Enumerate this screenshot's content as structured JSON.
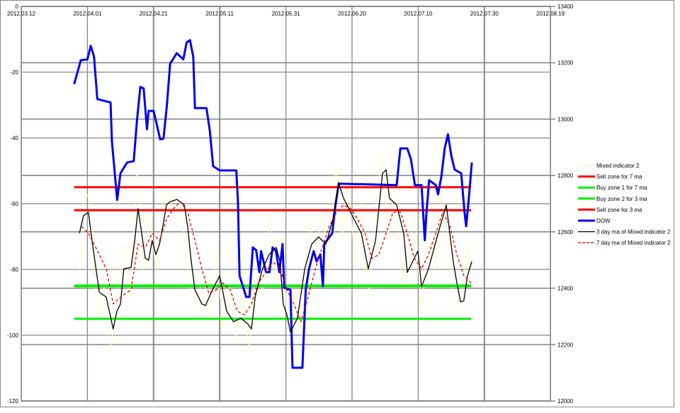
{
  "chart_data": {
    "type": "line",
    "title": "",
    "x_unit": "days since 2012.03.12",
    "x_ticks": [
      "2012.03.12",
      "2012.04.01",
      "2012.04.21",
      "2012.05.11",
      "2012.05.31",
      "2012.06.20",
      "2012.07.10",
      "2012.07.30",
      "2012.08.19"
    ],
    "xlim": [
      0,
      160
    ],
    "y_left": {
      "ticks": [
        "0",
        "-20",
        "-40",
        "-60",
        "-80",
        "-100",
        "-120"
      ],
      "ylim": [
        -120,
        0
      ]
    },
    "y_right": {
      "ticks": [
        "13400",
        "13200",
        "13000",
        "12800",
        "12600",
        "12400",
        "12200",
        "12000"
      ],
      "ylim": [
        12000,
        13400
      ]
    },
    "grid": true,
    "legend_position": "right",
    "series": [
      {
        "name": "Mixed indicator 2",
        "axis": "left",
        "color": "#ffffc8",
        "width": 1,
        "dash": false,
        "points": [
          [
            17.6,
            -80
          ],
          [
            19,
            -55
          ],
          [
            21,
            -60
          ],
          [
            23,
            -95
          ],
          [
            25,
            -85
          ],
          [
            27,
            -105
          ],
          [
            29,
            -88
          ],
          [
            31,
            -72
          ],
          [
            33,
            -88
          ],
          [
            35,
            -50
          ],
          [
            37,
            -80
          ],
          [
            39,
            -62
          ],
          [
            41,
            -85
          ],
          [
            43,
            -55
          ],
          [
            45,
            -62
          ],
          [
            47,
            -52
          ],
          [
            49,
            -68
          ],
          [
            51,
            -85
          ],
          [
            53,
            -92
          ],
          [
            55,
            -80
          ],
          [
            57,
            -96
          ],
          [
            59,
            -75
          ],
          [
            61,
            -98
          ],
          [
            63,
            -85
          ],
          [
            65,
            -102
          ],
          [
            67,
            -88
          ],
          [
            69,
            -105
          ],
          [
            71,
            -75
          ],
          [
            73,
            -88
          ],
          [
            75,
            -62
          ],
          [
            77,
            -82
          ],
          [
            79,
            -70
          ],
          [
            81,
            -108
          ],
          [
            83,
            -88
          ],
          [
            85,
            -100
          ],
          [
            87,
            -65
          ],
          [
            89,
            -78
          ],
          [
            91,
            -62
          ],
          [
            93,
            -80
          ],
          [
            95,
            -48
          ],
          [
            97,
            -70
          ],
          [
            99,
            -55
          ],
          [
            101,
            -80
          ],
          [
            103,
            -60
          ],
          [
            105,
            -88
          ],
          [
            107,
            -62
          ],
          [
            109,
            -45
          ],
          [
            111,
            -70
          ],
          [
            113,
            -52
          ],
          [
            115,
            -85
          ],
          [
            117,
            -75
          ],
          [
            119,
            -62
          ],
          [
            121,
            -95
          ],
          [
            123,
            -68
          ],
          [
            125,
            -80
          ],
          [
            127,
            -55
          ],
          [
            129,
            -70
          ],
          [
            131,
            -92
          ],
          [
            133,
            -88
          ],
          [
            135,
            -72
          ],
          [
            136,
            -80
          ]
        ]
      },
      {
        "name": "Sell zone for 7 ma",
        "axis": "left",
        "color": "#ff0000",
        "width": 3,
        "dash": false,
        "points": [
          [
            16,
            -55
          ],
          [
            136,
            -55
          ]
        ]
      },
      {
        "name": "Buy zone 1 for 7 ma",
        "axis": "left",
        "color": "#00ee00",
        "width": 4,
        "dash": false,
        "points": [
          [
            16,
            -85
          ],
          [
            136,
            -85
          ]
        ]
      },
      {
        "name": "Buy zone 2 for 3 ma",
        "axis": "left",
        "color": "#00ee00",
        "width": 3,
        "dash": false,
        "points": [
          [
            16,
            -95
          ],
          [
            136,
            -95
          ]
        ]
      },
      {
        "name": "Sell zone for 3 ma",
        "axis": "left",
        "color": "#ff0000",
        "width": 3,
        "dash": false,
        "points": [
          [
            16,
            -62
          ],
          [
            136,
            -62
          ]
        ]
      },
      {
        "name": "DOW",
        "axis": "right",
        "color": "#0000ee",
        "width": 3,
        "dash": false,
        "points": [
          [
            16,
            13124
          ],
          [
            18,
            13209
          ],
          [
            20,
            13212
          ],
          [
            21,
            13260
          ],
          [
            22,
            13222
          ],
          [
            23,
            13071
          ],
          [
            27,
            13059
          ],
          [
            27.4,
            12921
          ],
          [
            29,
            12713
          ],
          [
            30,
            12808
          ],
          [
            32,
            12846
          ],
          [
            34,
            12851
          ],
          [
            35,
            12996
          ],
          [
            36,
            13114
          ],
          [
            37,
            13109
          ],
          [
            38,
            12964
          ],
          [
            38.5,
            13029
          ],
          [
            40,
            13029
          ],
          [
            41,
            12979
          ],
          [
            42,
            12928
          ],
          [
            43,
            12931
          ],
          [
            44,
            13046
          ],
          [
            45,
            13197
          ],
          [
            47,
            13234
          ],
          [
            49,
            13212
          ],
          [
            50,
            13272
          ],
          [
            51,
            13280
          ],
          [
            52,
            13222
          ],
          [
            52.5,
            13039
          ],
          [
            56,
            13039
          ],
          [
            57,
            12959
          ],
          [
            58,
            12833
          ],
          [
            60,
            12818
          ],
          [
            65,
            12818
          ],
          [
            65.5,
            12708
          ],
          [
            66,
            12444
          ],
          [
            68,
            12369
          ],
          [
            69,
            12369
          ],
          [
            70,
            12545
          ],
          [
            71,
            12535
          ],
          [
            72,
            12457
          ],
          [
            72.5,
            12532
          ],
          [
            74,
            12457
          ],
          [
            75,
            12457
          ],
          [
            76,
            12545
          ],
          [
            77,
            12532
          ],
          [
            78,
            12457
          ],
          [
            79,
            12557
          ],
          [
            79.5,
            12402
          ],
          [
            81.4,
            12394
          ],
          [
            82,
            12118
          ],
          [
            85,
            12118
          ],
          [
            86,
            12394
          ],
          [
            87,
            12470
          ],
          [
            88.4,
            12532
          ],
          [
            89.3,
            12495
          ],
          [
            90.4,
            12520
          ],
          [
            91.2,
            12407
          ],
          [
            91.6,
            12557
          ],
          [
            94,
            12595
          ],
          [
            95,
            12695
          ],
          [
            96,
            12771
          ],
          [
            113.5,
            12766
          ],
          [
            114.6,
            12896
          ],
          [
            116.7,
            12896
          ],
          [
            117.8,
            12858
          ],
          [
            119,
            12766
          ],
          [
            121,
            12766
          ],
          [
            122,
            12570
          ],
          [
            122.5,
            12670
          ],
          [
            123.3,
            12783
          ],
          [
            125.3,
            12766
          ],
          [
            126,
            12733
          ],
          [
            127,
            12796
          ],
          [
            128,
            12896
          ],
          [
            129,
            12946
          ],
          [
            130,
            12871
          ],
          [
            131,
            12821
          ],
          [
            133,
            12808
          ],
          [
            134,
            12670
          ],
          [
            134.5,
            12620
          ],
          [
            135.3,
            12720
          ],
          [
            136.2,
            12846
          ]
        ]
      },
      {
        "name": "3 day ma of Mixed indicator 2",
        "axis": "left",
        "color": "#000000",
        "width": 1.3,
        "dash": false,
        "points": [
          [
            17.6,
            -69
          ],
          [
            18.8,
            -63.7
          ],
          [
            20.3,
            -62.6
          ],
          [
            21.4,
            -71.2
          ],
          [
            23.6,
            -86.9
          ],
          [
            25.7,
            -88.4
          ],
          [
            27.8,
            -98.1
          ],
          [
            28.9,
            -92.7
          ],
          [
            30,
            -90.5
          ],
          [
            31,
            -79.8
          ],
          [
            33.2,
            -79.4
          ],
          [
            34.3,
            -71.2
          ],
          [
            35.3,
            -61.5
          ],
          [
            36.4,
            -69
          ],
          [
            37.5,
            -76.6
          ],
          [
            38.5,
            -77.2
          ],
          [
            39.6,
            -71.2
          ],
          [
            40.7,
            -75.5
          ],
          [
            41.8,
            -72.3
          ],
          [
            42.8,
            -66.9
          ],
          [
            43.9,
            -60.4
          ],
          [
            45,
            -59.4
          ],
          [
            47.1,
            -58.7
          ],
          [
            49.3,
            -60.4
          ],
          [
            50.3,
            -66.9
          ],
          [
            51.4,
            -77.6
          ],
          [
            52.5,
            -86.2
          ],
          [
            54.6,
            -90.5
          ],
          [
            55.7,
            -91
          ],
          [
            57.8,
            -86.2
          ],
          [
            60,
            -81.9
          ],
          [
            62.1,
            -92.7
          ],
          [
            64.2,
            -95.9
          ],
          [
            66.4,
            -94.8
          ],
          [
            68.5,
            -96.6
          ],
          [
            69.6,
            -98.1
          ],
          [
            70.7,
            -88.4
          ],
          [
            72.8,
            -80.2
          ],
          [
            74.9,
            -75.5
          ],
          [
            77.1,
            -73.3
          ],
          [
            78.2,
            -77.6
          ],
          [
            79.2,
            -90.5
          ],
          [
            80.3,
            -93.8
          ],
          [
            81.4,
            -99.1
          ],
          [
            83.5,
            -94.8
          ],
          [
            85.7,
            -79.8
          ],
          [
            87.8,
            -72.3
          ],
          [
            89.9,
            -70.1
          ],
          [
            92.1,
            -72.3
          ],
          [
            94.2,
            -64.7
          ],
          [
            95.9,
            -53.5
          ],
          [
            97.4,
            -58.3
          ],
          [
            98.5,
            -60.4
          ],
          [
            100.6,
            -64.7
          ],
          [
            102.8,
            -69
          ],
          [
            104.9,
            -79.8
          ],
          [
            107.1,
            -71.2
          ],
          [
            109.2,
            -50.8
          ],
          [
            110.3,
            -49.7
          ],
          [
            111.3,
            -58.3
          ],
          [
            113.5,
            -60.4
          ],
          [
            115.6,
            -69
          ],
          [
            116.7,
            -80.9
          ],
          [
            119.9,
            -74.4
          ],
          [
            121,
            -85.2
          ],
          [
            123.1,
            -79.8
          ],
          [
            126.3,
            -68
          ],
          [
            128.5,
            -60.4
          ],
          [
            130.6,
            -77.6
          ],
          [
            131.7,
            -84.1
          ],
          [
            132.8,
            -89.9
          ],
          [
            133.8,
            -89.5
          ],
          [
            134.9,
            -81.9
          ],
          [
            136.2,
            -77.6
          ]
        ]
      },
      {
        "name": "7 day ma of Mixed indicator 2",
        "axis": "left",
        "color": "#ee0000",
        "width": 1.3,
        "dash": true,
        "points": [
          [
            18.2,
            -66.9
          ],
          [
            20.3,
            -69
          ],
          [
            22.5,
            -73.3
          ],
          [
            25.7,
            -79.8
          ],
          [
            27.8,
            -90.5
          ],
          [
            30,
            -88.4
          ],
          [
            33.2,
            -86.2
          ],
          [
            35.3,
            -72.3
          ],
          [
            37.5,
            -73.3
          ],
          [
            39.6,
            -69
          ],
          [
            41.8,
            -71.2
          ],
          [
            43.9,
            -64.7
          ],
          [
            46,
            -61.5
          ],
          [
            48.2,
            -59.4
          ],
          [
            50.3,
            -62.6
          ],
          [
            52.5,
            -71.2
          ],
          [
            54.6,
            -79.8
          ],
          [
            56.7,
            -87.3
          ],
          [
            58.9,
            -86.2
          ],
          [
            61,
            -84.1
          ],
          [
            63.2,
            -86.2
          ],
          [
            65.3,
            -92.7
          ],
          [
            67.5,
            -93.8
          ],
          [
            69.6,
            -90.5
          ],
          [
            71.7,
            -84.1
          ],
          [
            73.9,
            -80.9
          ],
          [
            76,
            -77.6
          ],
          [
            78.2,
            -79.8
          ],
          [
            80.3,
            -86.2
          ],
          [
            82.4,
            -90.5
          ],
          [
            84.6,
            -95.9
          ],
          [
            86.7,
            -88.4
          ],
          [
            88.9,
            -79.8
          ],
          [
            91,
            -73.3
          ],
          [
            93.1,
            -66.9
          ],
          [
            95.3,
            -62.6
          ],
          [
            97.4,
            -60.4
          ],
          [
            99.6,
            -61.5
          ],
          [
            101.7,
            -64.7
          ],
          [
            103.9,
            -69
          ],
          [
            106,
            -76.6
          ],
          [
            108.1,
            -75.5
          ],
          [
            110.3,
            -69
          ],
          [
            112.4,
            -62.6
          ],
          [
            114.6,
            -62.6
          ],
          [
            116.7,
            -69
          ],
          [
            118.8,
            -76.6
          ],
          [
            121,
            -79.8
          ],
          [
            123.1,
            -75.5
          ],
          [
            125.3,
            -69
          ],
          [
            127.4,
            -62.6
          ],
          [
            129.6,
            -66.9
          ],
          [
            131.7,
            -75.5
          ],
          [
            133.8,
            -81.9
          ],
          [
            136,
            -84.1
          ]
        ]
      }
    ]
  }
}
